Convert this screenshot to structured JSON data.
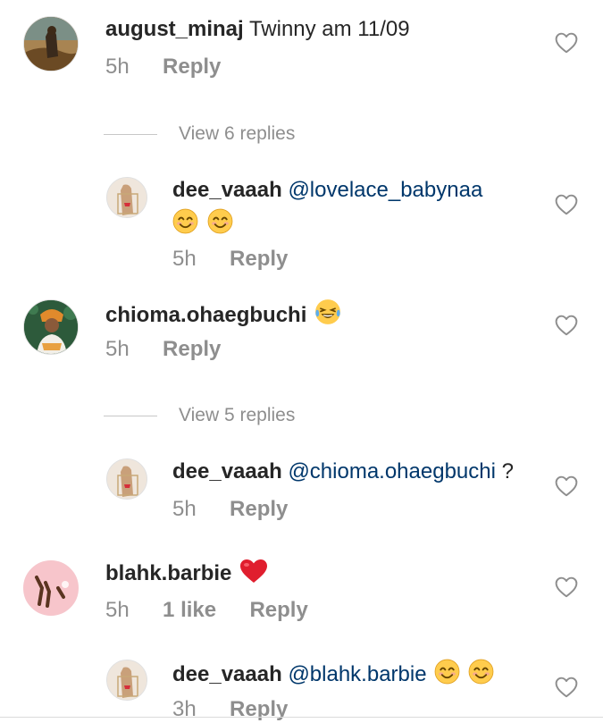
{
  "comments": [
    {
      "username": "august_minaj",
      "text": "Twinny am 11/09",
      "time": "5h",
      "reply_label": "Reply"
    },
    {
      "view_replies": "View 6 replies"
    },
    {
      "username": "dee_vaaah",
      "mention": "@lovelace_babynaa",
      "time": "5h",
      "reply_label": "Reply"
    },
    {
      "username": "chioma.ohaegbuchi",
      "time": "5h",
      "reply_label": "Reply"
    },
    {
      "view_replies": "View 5 replies"
    },
    {
      "username": "dee_vaaah",
      "mention": "@chioma.ohaegbuchi",
      "text": " ?",
      "time": "5h",
      "reply_label": "Reply"
    },
    {
      "username": "blahk.barbie",
      "time": "5h",
      "likes": "1 like",
      "reply_label": "Reply"
    },
    {
      "username": "dee_vaaah",
      "mention": "@blahk.barbie",
      "time": "3h",
      "reply_label": "Reply"
    }
  ],
  "colors": {
    "mention": "#00376b",
    "meta": "#8e8e8e",
    "heart_red": "#ed4956"
  },
  "icons": {
    "like": "heart-outline-icon",
    "smile": "smiling-face-emoji",
    "laugh": "tears-of-joy-emoji",
    "heart": "red-heart-emoji"
  }
}
